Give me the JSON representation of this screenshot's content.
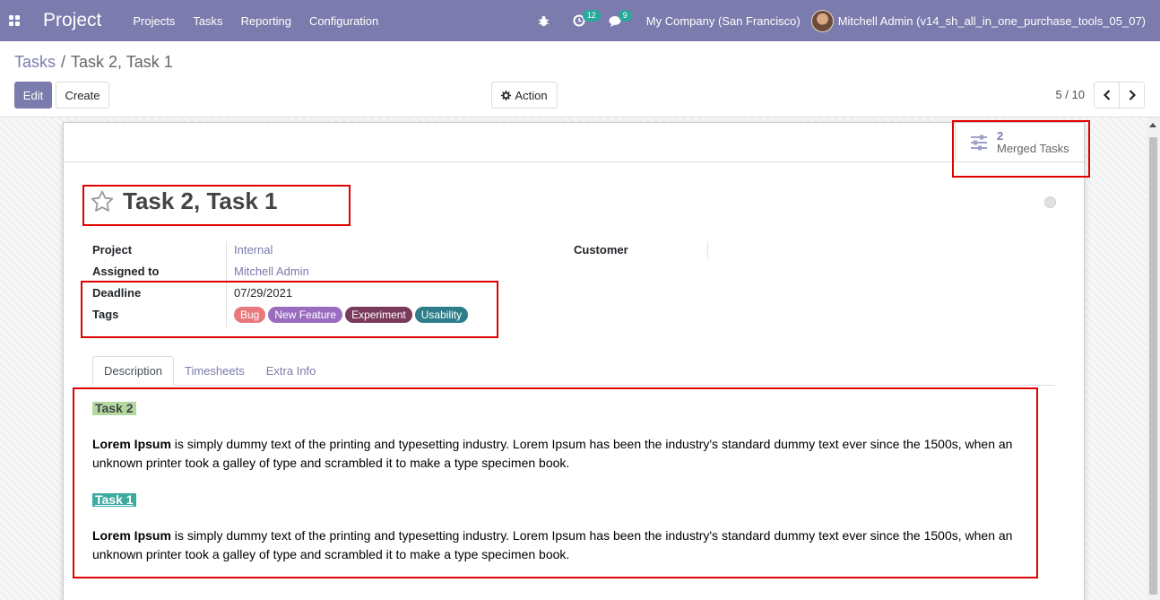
{
  "navbar": {
    "app_name": "Project",
    "menu": [
      "Projects",
      "Tasks",
      "Reporting",
      "Configuration"
    ],
    "activity_count": "12",
    "messages_count": "9",
    "company": "My Company (San Francisco)",
    "user": "Mitchell Admin (v14_sh_all_in_one_purchase_tools_05_07)"
  },
  "breadcrumb": {
    "parent": "Tasks",
    "separator": "/",
    "current": "Task 2, Task 1"
  },
  "toolbar": {
    "edit_label": "Edit",
    "create_label": "Create",
    "action_label": "Action",
    "pager": "5 / 10"
  },
  "smart_button": {
    "count": "2",
    "label": "Merged Tasks"
  },
  "form": {
    "title": "Task 2, Task 1",
    "project_label": "Project",
    "project_value": "Internal",
    "assigned_label": "Assigned to",
    "assigned_value": "Mitchell Admin",
    "deadline_label": "Deadline",
    "deadline_value": "07/29/2021",
    "tags_label": "Tags",
    "customer_label": "Customer",
    "tags": [
      {
        "name": "Bug",
        "color": "#e9797c"
      },
      {
        "name": "New Feature",
        "color": "#9a6cbf"
      },
      {
        "name": "Experiment",
        "color": "#7a3a5c"
      },
      {
        "name": "Usability",
        "color": "#2d7d8a"
      }
    ]
  },
  "tabs": [
    "Description",
    "Timesheets",
    "Extra Info"
  ],
  "description": {
    "heading1": "Task 2",
    "bold1": "Lorem Ipsum",
    "text1": " is simply dummy text of the printing and typesetting industry. Lorem Ipsum has been the industry's standard dummy text ever since the 1500s, when an unknown printer took a galley of type and scrambled it to make a type specimen book.",
    "heading2": "Task 1",
    "bold2": "Lorem Ipsum",
    "text2": " is simply dummy text of the printing and typesetting industry. Lorem Ipsum has been the industry's standard dummy text ever since the 1500s, when an unknown printer took a galley of type and scrambled it to make a type specimen book."
  },
  "colors": {
    "brand": "#7c7bad",
    "badge": "#28a99c",
    "annotation": "#e00000"
  }
}
